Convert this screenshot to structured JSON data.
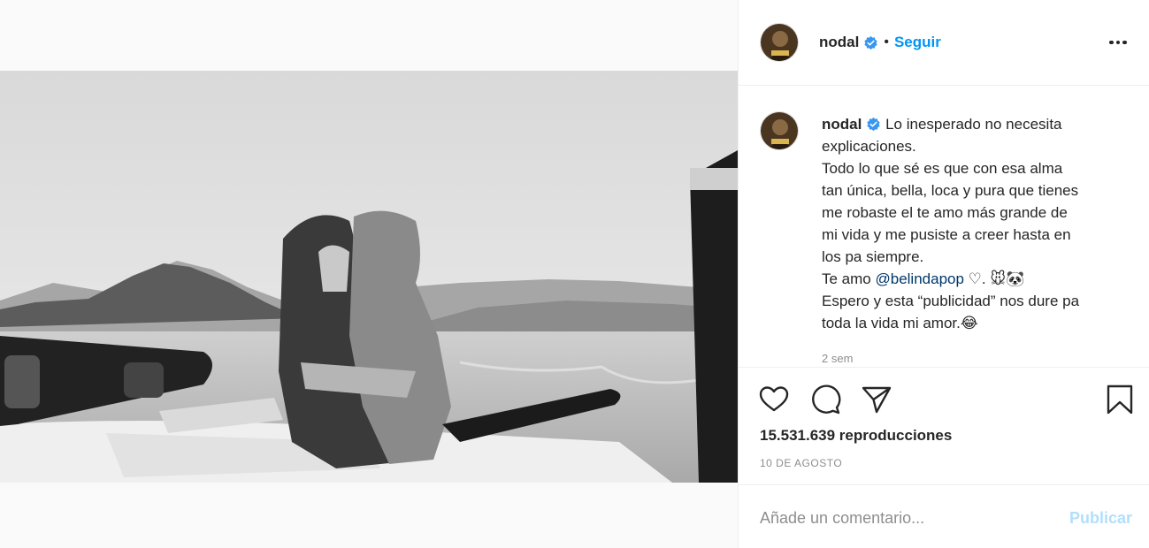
{
  "post": {
    "username": "nodal",
    "dot": "•",
    "follow_label": "Seguir",
    "caption_lines": [
      "Lo inesperado no necesita",
      "explicaciones.",
      "Todo lo que sé es que con esa alma",
      "tan única, bella, loca y pura que tienes",
      "me robaste el te amo más grande de",
      "mi vida y me pusiste a creer hasta en",
      "los pa siempre."
    ],
    "caption_mention_prefix": "Te amo ",
    "caption_mention": "@belindapop",
    "caption_mention_suffix": " ♡. 🐭🐼",
    "caption_end_lines": [
      "Espero y esta “publicidad” nos dure pa",
      "toda la vida mi amor.😂"
    ],
    "relative_time": "2 sem",
    "views": "15.531.639 reproducciones",
    "date": "10 DE AGOSTO",
    "comment_placeholder": "Añade un comentario...",
    "publish_label": "Publicar"
  },
  "icons": {
    "like": "heart-icon",
    "comment": "comment-icon",
    "share": "paper-plane-icon",
    "save": "bookmark-icon",
    "more": "more-options-icon",
    "verified": "verified-badge-icon"
  },
  "colors": {
    "accent": "#0095f6",
    "verified": "#3897f0",
    "publish_disabled": "#b2dffc",
    "secondary_text": "#8e8e8e"
  }
}
